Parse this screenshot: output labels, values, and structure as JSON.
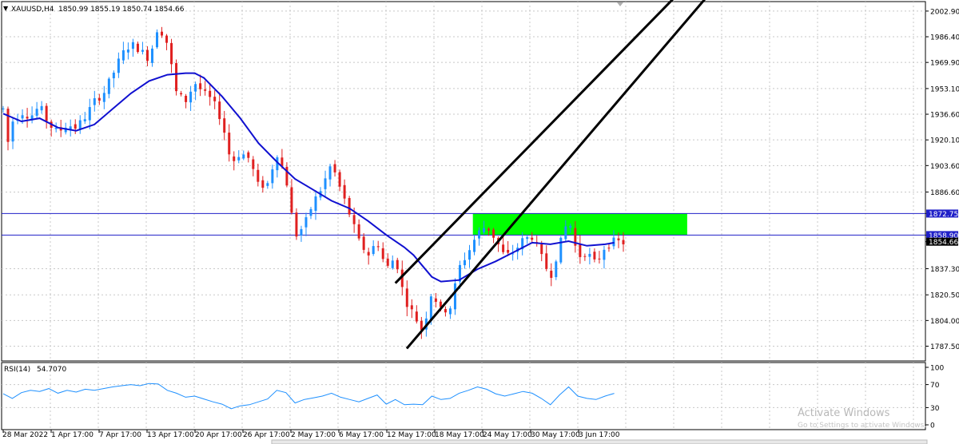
{
  "window": {
    "menu_glyph": "▼",
    "symbol_label": "XAUUSD,H4",
    "ohlc": "1850.99 1855.19 1850.74 1854.66",
    "watermark_line1": "Activate Windows",
    "watermark_line2": "Go to Settings to activate Windows."
  },
  "colors": {
    "bull": "#1e90ff",
    "bear": "#e02020",
    "ma": "#1010d0",
    "hline": "#2020c8",
    "channel": "#000000",
    "zone": "#00ff00",
    "rsi": "#1e90ff",
    "grid": "#c8c8c8"
  },
  "chart_data": [
    {
      "type": "candlestick",
      "title": "XAUUSD,H4",
      "ylim": [
        1778.0,
        2009.0
      ],
      "y_ticks": [
        2002.9,
        1986.4,
        1969.9,
        1953.1,
        1936.6,
        1920.1,
        1903.6,
        1886.6,
        1872.75,
        1858.9,
        1854.66,
        1837.3,
        1820.5,
        1804.0,
        1787.5
      ],
      "y_tick_labels": [
        "2002.90",
        "1986.40",
        "1969.90",
        "1953.10",
        "1936.60",
        "1920.10",
        "1903.60",
        "1886.60",
        "1872.75",
        "1858.90",
        "1854.66",
        "1837.30",
        "1820.50",
        "1804.00",
        "1787.50"
      ],
      "highlighted_labels": [
        "1872.75",
        "1858.90",
        "1854.66"
      ],
      "x_labels": [
        "28 Mar 2022",
        "1 Apr 17:00",
        "7 Apr 17:00",
        "13 Apr 17:00",
        "20 Apr 17:00",
        "26 Apr 17:00",
        "2 May 17:00",
        "6 May 17:00",
        "12 May 17:00",
        "18 May 17:00",
        "24 May 17:00",
        "30 May 17:00",
        "3 Jun 17:00"
      ],
      "x_range": [
        0,
        136
      ],
      "bars": 130,
      "price_path": [
        [
          0,
          1940
        ],
        [
          1,
          1918
        ],
        [
          2,
          1932
        ],
        [
          4,
          1938
        ],
        [
          6,
          1935
        ],
        [
          8,
          1942
        ],
        [
          10,
          1930
        ],
        [
          12,
          1925
        ],
        [
          14,
          1930
        ],
        [
          16,
          1928
        ],
        [
          18,
          1935
        ],
        [
          20,
          1945
        ],
        [
          22,
          1950
        ],
        [
          24,
          1962
        ],
        [
          26,
          1975
        ],
        [
          28,
          1982
        ],
        [
          30,
          1978
        ],
        [
          32,
          1972
        ],
        [
          34,
          1994
        ],
        [
          36,
          1982
        ],
        [
          38,
          1950
        ],
        [
          40,
          1945
        ],
        [
          42,
          1957
        ],
        [
          44,
          1950
        ],
        [
          46,
          1945
        ],
        [
          48,
          1932
        ],
        [
          50,
          1905
        ],
        [
          52,
          1912
        ],
        [
          54,
          1908
        ],
        [
          56,
          1890
        ],
        [
          58,
          1892
        ],
        [
          60,
          1912
        ],
        [
          62,
          1896
        ],
        [
          64,
          1858
        ],
        [
          66,
          1865
        ],
        [
          68,
          1880
        ],
        [
          70,
          1890
        ],
        [
          72,
          1905
        ],
        [
          74,
          1888
        ],
        [
          76,
          1872
        ],
        [
          78,
          1855
        ],
        [
          80,
          1846
        ],
        [
          82,
          1855
        ],
        [
          84,
          1837
        ],
        [
          86,
          1845
        ],
        [
          88,
          1818
        ],
        [
          90,
          1808
        ],
        [
          92,
          1797
        ],
        [
          94,
          1823
        ],
        [
          96,
          1810
        ],
        [
          98,
          1812
        ],
        [
          100,
          1838
        ],
        [
          102,
          1848
        ],
        [
          104,
          1860
        ],
        [
          106,
          1865
        ],
        [
          108,
          1856
        ],
        [
          110,
          1845
        ],
        [
          112,
          1848
        ],
        [
          114,
          1856
        ],
        [
          116,
          1858
        ],
        [
          118,
          1845
        ],
        [
          120,
          1832
        ],
        [
          122,
          1852
        ],
        [
          124,
          1870
        ],
        [
          126,
          1845
        ],
        [
          128,
          1848
        ],
        [
          130,
          1840
        ],
        [
          132,
          1852
        ],
        [
          134,
          1855
        ],
        [
          136,
          1854
        ]
      ],
      "moving_average": [
        [
          0,
          1937
        ],
        [
          4,
          1932
        ],
        [
          8,
          1934
        ],
        [
          12,
          1928
        ],
        [
          16,
          1926
        ],
        [
          20,
          1930
        ],
        [
          24,
          1940
        ],
        [
          28,
          1950
        ],
        [
          32,
          1958
        ],
        [
          36,
          1962
        ],
        [
          40,
          1963
        ],
        [
          42,
          1963
        ],
        [
          44,
          1960
        ],
        [
          48,
          1948
        ],
        [
          52,
          1934
        ],
        [
          56,
          1918
        ],
        [
          60,
          1906
        ],
        [
          64,
          1895
        ],
        [
          68,
          1888
        ],
        [
          72,
          1881
        ],
        [
          76,
          1876
        ],
        [
          80,
          1868
        ],
        [
          84,
          1859
        ],
        [
          88,
          1851
        ],
        [
          90,
          1846
        ],
        [
          92,
          1839
        ],
        [
          94,
          1832
        ],
        [
          96,
          1829
        ],
        [
          100,
          1830
        ],
        [
          104,
          1837
        ],
        [
          108,
          1842
        ],
        [
          112,
          1848
        ],
        [
          116,
          1854
        ],
        [
          120,
          1853
        ],
        [
          124,
          1855
        ],
        [
          128,
          1852
        ],
        [
          132,
          1853
        ],
        [
          134,
          1854
        ]
      ],
      "horizontal_lines": [
        1872.75,
        1858.9
      ],
      "channel_lines": [
        {
          "from": [
            88.5,
            1786
          ],
          "to": [
            154,
            2011
          ]
        },
        {
          "from": [
            86,
            1828
          ],
          "to": [
            147,
            2011
          ]
        }
      ],
      "zone": {
        "x": [
          103,
          150
        ],
        "y": [
          1858.9,
          1872.75
        ]
      }
    },
    {
      "type": "line",
      "title": "RSI(14)",
      "value_label": "54.7070",
      "ylim": [
        0,
        100
      ],
      "y_ticks": [
        100,
        70,
        30,
        0
      ],
      "y_tick_labels": [
        "100",
        "70",
        "30",
        "0"
      ],
      "values": [
        [
          0,
          54
        ],
        [
          2,
          46
        ],
        [
          4,
          56
        ],
        [
          6,
          60
        ],
        [
          8,
          58
        ],
        [
          10,
          63
        ],
        [
          12,
          55
        ],
        [
          14,
          60
        ],
        [
          16,
          57
        ],
        [
          18,
          62
        ],
        [
          20,
          60
        ],
        [
          22,
          63
        ],
        [
          24,
          66
        ],
        [
          26,
          68
        ],
        [
          28,
          70
        ],
        [
          30,
          68
        ],
        [
          32,
          72
        ],
        [
          34,
          71
        ],
        [
          36,
          60
        ],
        [
          38,
          55
        ],
        [
          40,
          48
        ],
        [
          42,
          50
        ],
        [
          44,
          45
        ],
        [
          46,
          40
        ],
        [
          48,
          36
        ],
        [
          50,
          28
        ],
        [
          52,
          33
        ],
        [
          54,
          35
        ],
        [
          56,
          40
        ],
        [
          58,
          45
        ],
        [
          60,
          60
        ],
        [
          62,
          56
        ],
        [
          64,
          38
        ],
        [
          66,
          44
        ],
        [
          68,
          47
        ],
        [
          70,
          50
        ],
        [
          72,
          55
        ],
        [
          74,
          48
        ],
        [
          76,
          44
        ],
        [
          78,
          40
        ],
        [
          80,
          46
        ],
        [
          82,
          52
        ],
        [
          84,
          36
        ],
        [
          86,
          44
        ],
        [
          88,
          35
        ],
        [
          90,
          36
        ],
        [
          92,
          35
        ],
        [
          94,
          50
        ],
        [
          96,
          44
        ],
        [
          98,
          46
        ],
        [
          100,
          55
        ],
        [
          102,
          60
        ],
        [
          104,
          66
        ],
        [
          106,
          62
        ],
        [
          108,
          54
        ],
        [
          110,
          50
        ],
        [
          112,
          54
        ],
        [
          114,
          58
        ],
        [
          116,
          55
        ],
        [
          118,
          46
        ],
        [
          120,
          35
        ],
        [
          122,
          52
        ],
        [
          124,
          66
        ],
        [
          126,
          50
        ],
        [
          128,
          46
        ],
        [
          130,
          44
        ],
        [
          132,
          50
        ],
        [
          134,
          54.7
        ]
      ]
    }
  ]
}
